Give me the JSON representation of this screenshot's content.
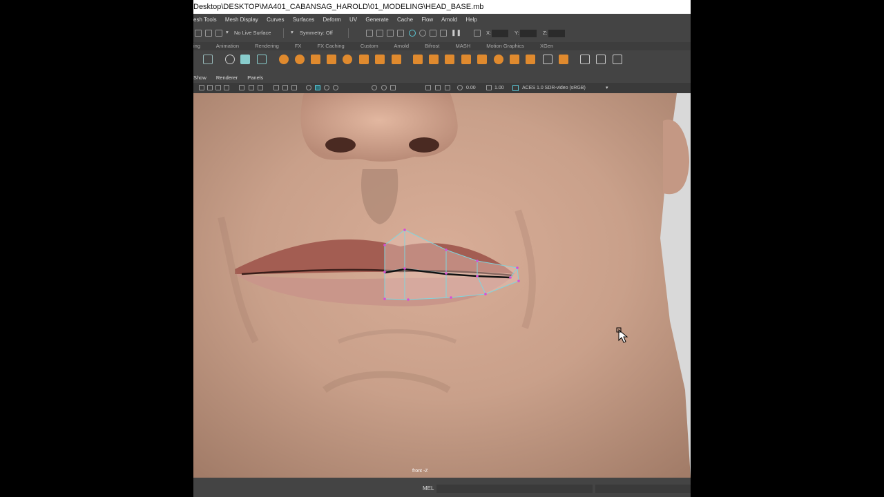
{
  "window": {
    "title": "Desktop\\DESKTOP\\MA401_CABANSAG_HAROLD\\01_MODELING\\HEAD_BASE.mb"
  },
  "menus": [
    "esh Tools",
    "Mesh Display",
    "Curves",
    "Surfaces",
    "Deform",
    "UV",
    "Generate",
    "Cache",
    "Flow",
    "Arnold",
    "Help"
  ],
  "status": {
    "live_surface": "No Live Surface",
    "symmetry": "Symmetry: Off",
    "x_label": "X:",
    "y_label": "Y:",
    "z_label": "Z:"
  },
  "shelf_tabs": [
    "ing",
    "Animation",
    "Rendering",
    "FX",
    "FX Caching",
    "Custom",
    "Arnold",
    "Bifrost",
    "MASH",
    "Motion Graphics",
    "XGen"
  ],
  "panel_menus": [
    "Show",
    "Renderer",
    "Panels"
  ],
  "panel_tools": {
    "exposure": "0.00",
    "gamma": "1.00",
    "colorspace": "ACES 1.0 SDR-video (sRGB)"
  },
  "viewport": {
    "camera_label": "front -Z"
  },
  "command_line": {
    "language": "MEL"
  },
  "colors": {
    "accent": "#5bc8d6",
    "ui_bg": "#444444",
    "vertex": "#d64fd6"
  }
}
